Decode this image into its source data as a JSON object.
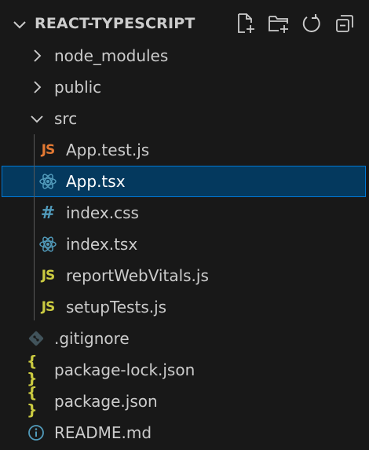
{
  "explorer": {
    "title": "REACT-TYPESCRIPT",
    "actions": [
      {
        "name": "new-file-icon"
      },
      {
        "name": "new-folder-icon"
      },
      {
        "name": "refresh-icon"
      },
      {
        "name": "collapse-all-icon"
      }
    ]
  },
  "tree": {
    "items": [
      {
        "label": "node_modules",
        "type": "folder",
        "expanded": false
      },
      {
        "label": "public",
        "type": "folder",
        "expanded": false
      },
      {
        "label": "src",
        "type": "folder",
        "expanded": true
      },
      {
        "label": "App.test.js",
        "type": "file",
        "icon": "JS",
        "icon_name": "javascript-test-icon"
      },
      {
        "label": "App.tsx",
        "type": "file",
        "icon_name": "react-icon",
        "selected": true
      },
      {
        "label": "index.css",
        "type": "file",
        "icon": "#",
        "icon_name": "css-icon"
      },
      {
        "label": "index.tsx",
        "type": "file",
        "icon_name": "react-icon"
      },
      {
        "label": "reportWebVitals.js",
        "type": "file",
        "icon": "JS",
        "icon_name": "javascript-icon"
      },
      {
        "label": "setupTests.js",
        "type": "file",
        "icon": "JS",
        "icon_name": "javascript-icon"
      },
      {
        "label": ".gitignore",
        "type": "file",
        "icon_name": "git-icon"
      },
      {
        "label": "package-lock.json",
        "type": "file",
        "icon": "{ }",
        "icon_name": "json-icon"
      },
      {
        "label": "package.json",
        "type": "file",
        "icon": "{ }",
        "icon_name": "json-icon"
      },
      {
        "label": "README.md",
        "type": "file",
        "icon_name": "info-icon"
      }
    ]
  },
  "colors": {
    "background": "#181818",
    "selection": "#04395e",
    "selection_border": "#0078d4",
    "text": "#cccccc",
    "js_yellow": "#cbcb41",
    "js_orange": "#e37933",
    "react_blue": "#519aba"
  }
}
